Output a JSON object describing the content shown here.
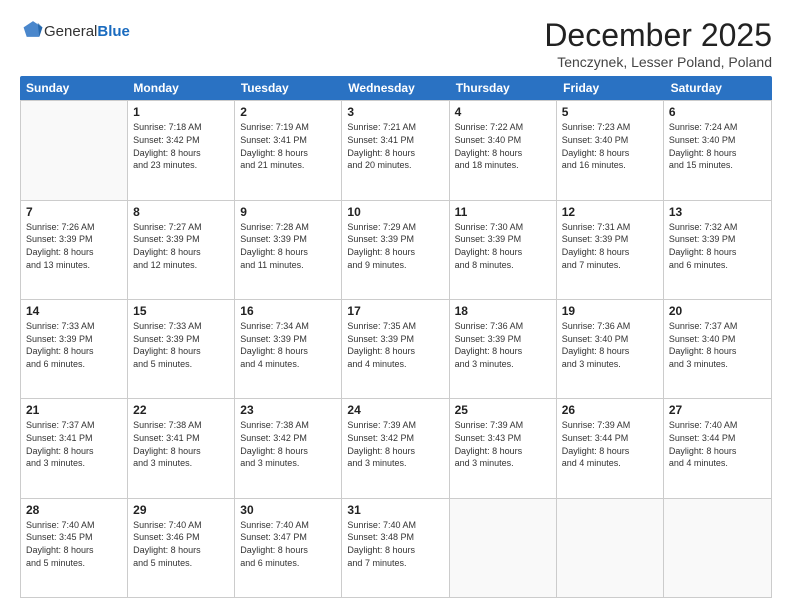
{
  "header": {
    "logo_general": "General",
    "logo_blue": "Blue",
    "month_title": "December 2025",
    "location": "Tenczynek, Lesser Poland, Poland"
  },
  "calendar": {
    "days_of_week": [
      "Sunday",
      "Monday",
      "Tuesday",
      "Wednesday",
      "Thursday",
      "Friday",
      "Saturday"
    ],
    "weeks": [
      [
        {
          "day": null,
          "info": ""
        },
        {
          "day": "1",
          "info": "Sunrise: 7:18 AM\nSunset: 3:42 PM\nDaylight: 8 hours\nand 23 minutes."
        },
        {
          "day": "2",
          "info": "Sunrise: 7:19 AM\nSunset: 3:41 PM\nDaylight: 8 hours\nand 21 minutes."
        },
        {
          "day": "3",
          "info": "Sunrise: 7:21 AM\nSunset: 3:41 PM\nDaylight: 8 hours\nand 20 minutes."
        },
        {
          "day": "4",
          "info": "Sunrise: 7:22 AM\nSunset: 3:40 PM\nDaylight: 8 hours\nand 18 minutes."
        },
        {
          "day": "5",
          "info": "Sunrise: 7:23 AM\nSunset: 3:40 PM\nDaylight: 8 hours\nand 16 minutes."
        },
        {
          "day": "6",
          "info": "Sunrise: 7:24 AM\nSunset: 3:40 PM\nDaylight: 8 hours\nand 15 minutes."
        }
      ],
      [
        {
          "day": "7",
          "info": "Sunrise: 7:26 AM\nSunset: 3:39 PM\nDaylight: 8 hours\nand 13 minutes."
        },
        {
          "day": "8",
          "info": "Sunrise: 7:27 AM\nSunset: 3:39 PM\nDaylight: 8 hours\nand 12 minutes."
        },
        {
          "day": "9",
          "info": "Sunrise: 7:28 AM\nSunset: 3:39 PM\nDaylight: 8 hours\nand 11 minutes."
        },
        {
          "day": "10",
          "info": "Sunrise: 7:29 AM\nSunset: 3:39 PM\nDaylight: 8 hours\nand 9 minutes."
        },
        {
          "day": "11",
          "info": "Sunrise: 7:30 AM\nSunset: 3:39 PM\nDaylight: 8 hours\nand 8 minutes."
        },
        {
          "day": "12",
          "info": "Sunrise: 7:31 AM\nSunset: 3:39 PM\nDaylight: 8 hours\nand 7 minutes."
        },
        {
          "day": "13",
          "info": "Sunrise: 7:32 AM\nSunset: 3:39 PM\nDaylight: 8 hours\nand 6 minutes."
        }
      ],
      [
        {
          "day": "14",
          "info": "Sunrise: 7:33 AM\nSunset: 3:39 PM\nDaylight: 8 hours\nand 6 minutes."
        },
        {
          "day": "15",
          "info": "Sunrise: 7:33 AM\nSunset: 3:39 PM\nDaylight: 8 hours\nand 5 minutes."
        },
        {
          "day": "16",
          "info": "Sunrise: 7:34 AM\nSunset: 3:39 PM\nDaylight: 8 hours\nand 4 minutes."
        },
        {
          "day": "17",
          "info": "Sunrise: 7:35 AM\nSunset: 3:39 PM\nDaylight: 8 hours\nand 4 minutes."
        },
        {
          "day": "18",
          "info": "Sunrise: 7:36 AM\nSunset: 3:39 PM\nDaylight: 8 hours\nand 3 minutes."
        },
        {
          "day": "19",
          "info": "Sunrise: 7:36 AM\nSunset: 3:40 PM\nDaylight: 8 hours\nand 3 minutes."
        },
        {
          "day": "20",
          "info": "Sunrise: 7:37 AM\nSunset: 3:40 PM\nDaylight: 8 hours\nand 3 minutes."
        }
      ],
      [
        {
          "day": "21",
          "info": "Sunrise: 7:37 AM\nSunset: 3:41 PM\nDaylight: 8 hours\nand 3 minutes."
        },
        {
          "day": "22",
          "info": "Sunrise: 7:38 AM\nSunset: 3:41 PM\nDaylight: 8 hours\nand 3 minutes."
        },
        {
          "day": "23",
          "info": "Sunrise: 7:38 AM\nSunset: 3:42 PM\nDaylight: 8 hours\nand 3 minutes."
        },
        {
          "day": "24",
          "info": "Sunrise: 7:39 AM\nSunset: 3:42 PM\nDaylight: 8 hours\nand 3 minutes."
        },
        {
          "day": "25",
          "info": "Sunrise: 7:39 AM\nSunset: 3:43 PM\nDaylight: 8 hours\nand 3 minutes."
        },
        {
          "day": "26",
          "info": "Sunrise: 7:39 AM\nSunset: 3:44 PM\nDaylight: 8 hours\nand 4 minutes."
        },
        {
          "day": "27",
          "info": "Sunrise: 7:40 AM\nSunset: 3:44 PM\nDaylight: 8 hours\nand 4 minutes."
        }
      ],
      [
        {
          "day": "28",
          "info": "Sunrise: 7:40 AM\nSunset: 3:45 PM\nDaylight: 8 hours\nand 5 minutes."
        },
        {
          "day": "29",
          "info": "Sunrise: 7:40 AM\nSunset: 3:46 PM\nDaylight: 8 hours\nand 5 minutes."
        },
        {
          "day": "30",
          "info": "Sunrise: 7:40 AM\nSunset: 3:47 PM\nDaylight: 8 hours\nand 6 minutes."
        },
        {
          "day": "31",
          "info": "Sunrise: 7:40 AM\nSunset: 3:48 PM\nDaylight: 8 hours\nand 7 minutes."
        },
        {
          "day": null,
          "info": ""
        },
        {
          "day": null,
          "info": ""
        },
        {
          "day": null,
          "info": ""
        }
      ]
    ]
  }
}
